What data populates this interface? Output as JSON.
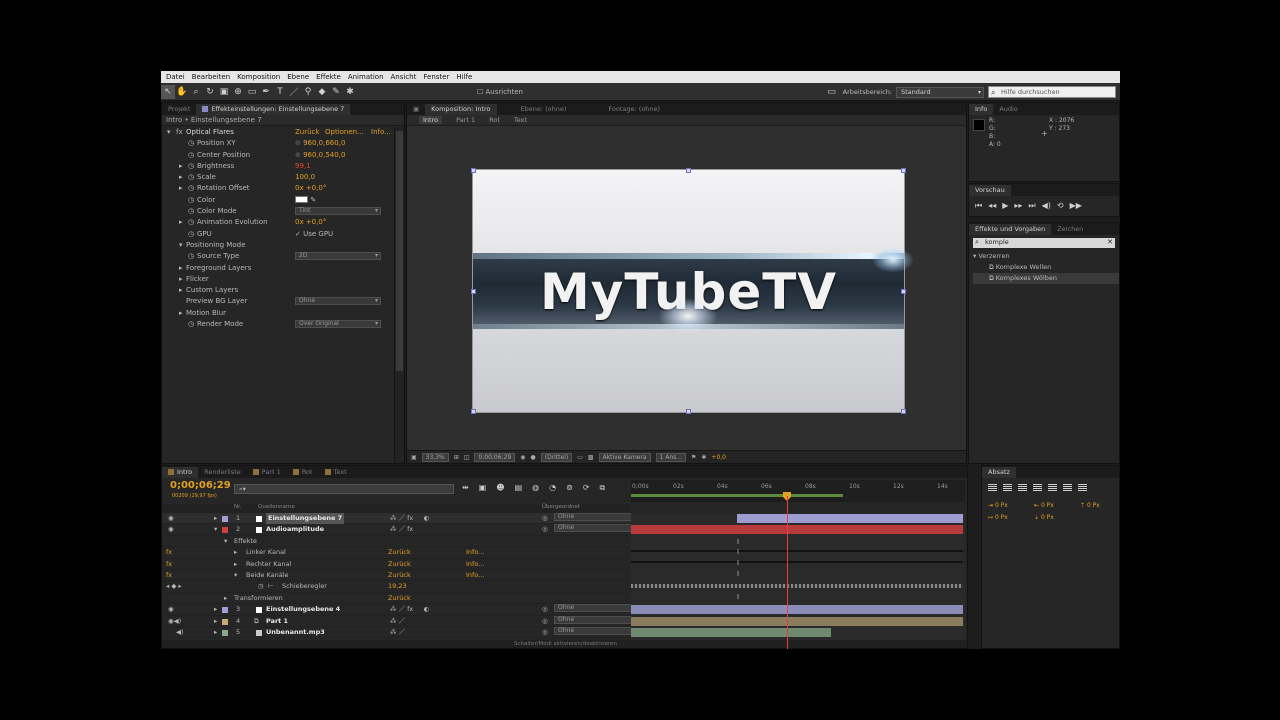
{
  "menu": [
    "Datei",
    "Bearbeiten",
    "Komposition",
    "Ebene",
    "Effekte",
    "Animation",
    "Ansicht",
    "Fenster",
    "Hilfe"
  ],
  "toolbar": {
    "align_label": "Ausrichten",
    "workspace_label": "Arbeitsbereich:",
    "workspace_value": "Standard",
    "help_placeholder": "Hilfe durchsuchen"
  },
  "effect_controls": {
    "tab_project": "Projekt",
    "tab_effect": "Effekteinstellungen: Einstellungsebene 7",
    "path": "Intro • Einstellungsebene 7",
    "effect_name": "Optical Flares",
    "reset": "Zurück",
    "options": "Optionen...",
    "info": "Info...",
    "rows": [
      {
        "name": "Position XY",
        "value": "960,0,660,0"
      },
      {
        "name": "Center Position",
        "value": "960,0,540,0"
      },
      {
        "name": "Brightness",
        "value": "99,1"
      },
      {
        "name": "Scale",
        "value": "100,0"
      },
      {
        "name": "Rotation Offset",
        "value": "0x +0,0°"
      },
      {
        "name": "Color",
        "value": ""
      },
      {
        "name": "Color Mode",
        "value": "Tint"
      },
      {
        "name": "Animation Evolution",
        "value": "0x +0,0°"
      },
      {
        "name": "GPU",
        "value": "✓ Use GPU"
      },
      {
        "name": "Positioning Mode",
        "value": ""
      },
      {
        "name": "Source Type",
        "value": "2D"
      },
      {
        "name": "Foreground Layers",
        "value": ""
      },
      {
        "name": "Flicker",
        "value": ""
      },
      {
        "name": "Custom Layers",
        "value": ""
      },
      {
        "name": "Preview BG Layer",
        "value": "Ohne"
      },
      {
        "name": "Motion Blur",
        "value": ""
      },
      {
        "name": "Render Mode",
        "value": "Over Original"
      }
    ]
  },
  "composition": {
    "tab": "Komposition: Intro",
    "tab_layer": "Ebene: (ohne)",
    "tab_footage": "Footage: (ohne)",
    "subtabs": [
      "Intro",
      "Part 1",
      "Rot",
      "Text"
    ],
    "logo_text": "MyTubeTV",
    "zoom": "33,3%",
    "timecode": "0;00;06;29",
    "resolution": "(Drittel)",
    "camera": "Aktive Kamera",
    "views": "1 Ans...",
    "exposure": "+0,0"
  },
  "info_panel": {
    "tab_info": "Info",
    "tab_audio": "Audio",
    "r": "R:",
    "g": "G:",
    "b": "B:",
    "a": "A:  0",
    "x": "X : 2076",
    "y": "Y : 273"
  },
  "preview_panel": {
    "tab": "Vorschau"
  },
  "effects_panel": {
    "tab": "Effekte und Vorgaben",
    "tab2": "Zeichen",
    "search": "komple",
    "category": "Verzerren",
    "items": [
      "Komplexe Wellen",
      "Komplexes Wölben"
    ]
  },
  "timeline": {
    "tabs": [
      "Intro",
      "Renderliste",
      "Part 1",
      "Rot",
      "Text"
    ],
    "timecode": "0;00;06;29",
    "timecode_sub": "00209 (29,97 fps)",
    "search_placeholder": "",
    "col_source": "Quellenname",
    "col_parent": "Übergeordnet",
    "col_nr": "Nr.",
    "ticks": [
      "0;00s",
      "02s",
      "04s",
      "06s",
      "08s",
      "10s",
      "12s",
      "14s"
    ],
    "footer": "Schalter/Modi aktivieren/deaktivieren",
    "layers": [
      {
        "nr": "1",
        "name": "Einstellungsebene 7",
        "parent": "Ohne",
        "bold": true
      },
      {
        "nr": "2",
        "name": "Audioamplitude",
        "parent": "Ohne",
        "bold": true
      },
      {
        "nr": "",
        "name": "Effekte",
        "parent": ""
      },
      {
        "nr": "",
        "name": "Linker Kanal",
        "reset": "Zurück",
        "info": "Info..."
      },
      {
        "nr": "",
        "name": "Rechter Kanal",
        "reset": "Zurück",
        "info": "Info..."
      },
      {
        "nr": "",
        "name": "Beide Kanäle",
        "reset": "Zurück",
        "info": "Info..."
      },
      {
        "nr": "",
        "name": "Schieberegler",
        "value": "19,23"
      },
      {
        "nr": "",
        "name": "Transformieren",
        "reset": "Zurück"
      },
      {
        "nr": "3",
        "name": "Einstellungsebene 4",
        "parent": "Ohne",
        "bold": true
      },
      {
        "nr": "4",
        "name": "Part 1",
        "parent": "Ohne",
        "bold": true
      },
      {
        "nr": "5",
        "name": "Unbenannt.mp3",
        "parent": "Ohne",
        "bold": true
      }
    ]
  },
  "paragraph_panel": {
    "tab": "Absatz",
    "vals": [
      "0 Px",
      "0 Px",
      "0 Px",
      "0 Px",
      "0 Px"
    ]
  }
}
